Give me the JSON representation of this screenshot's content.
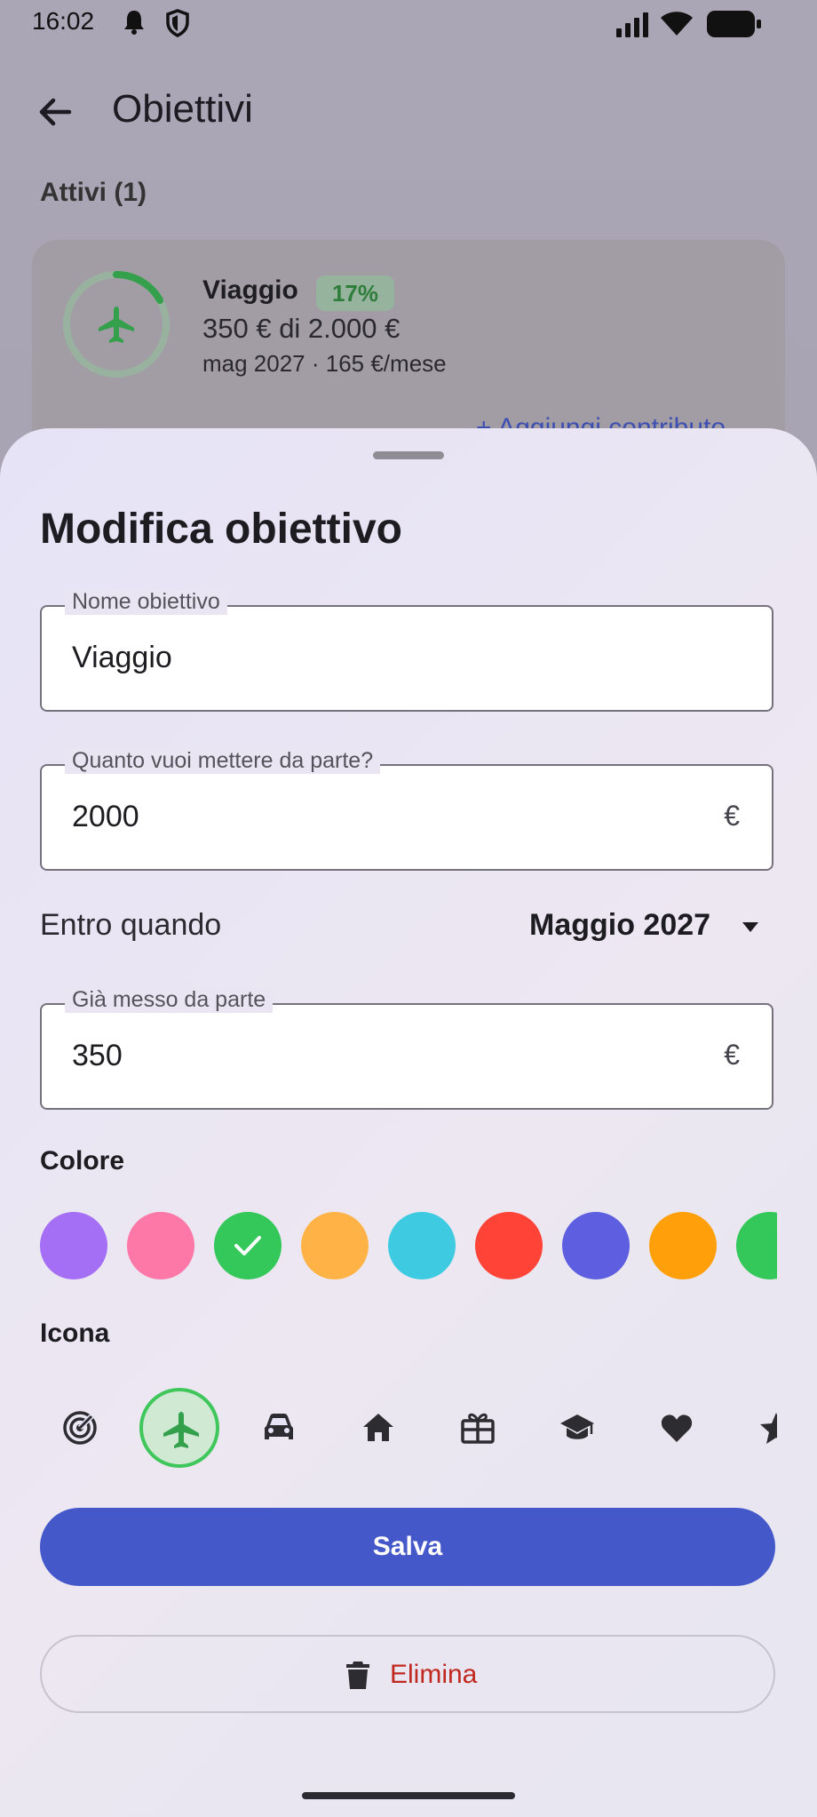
{
  "status_bar": {
    "time": "16:02"
  },
  "app_bar": {
    "title": "Obiettivi"
  },
  "section": {
    "label": "Attivi (1)"
  },
  "goal_card": {
    "name": "Viaggio",
    "percent": "17%",
    "progress": 0.17,
    "amount": "350 € di 2.000 €",
    "due": "mag 2027 · 165 €/mese",
    "add_contribution": "+ Aggiungi contributo"
  },
  "sheet": {
    "title": "Modifica obiettivo",
    "name_field": {
      "label": "Nome obiettivo",
      "value": "Viaggio"
    },
    "target_field": {
      "label": "Quanto vuoi mettere da parte?",
      "value": "2000",
      "suffix": "€"
    },
    "deadline": {
      "label": "Entro quando",
      "value": "Maggio 2027"
    },
    "saved_field": {
      "label": "Già messo da parte",
      "value": "350",
      "suffix": "€"
    },
    "color_label": "Colore",
    "colors": [
      "#a56ff5",
      "#fd77a7",
      "#34c759",
      "#ffb347",
      "#3ecbe2",
      "#ff4336",
      "#5d5fe0",
      "#ff9f0a",
      "#34c759"
    ],
    "selected_color_index": 2,
    "icon_label": "Icona",
    "icons": [
      "target-icon",
      "airplane-icon",
      "car-icon",
      "home-icon",
      "gift-icon",
      "graduation-cap-icon",
      "heart-icon",
      "star-icon"
    ],
    "selected_icon_index": 1,
    "save_label": "Salva",
    "delete_label": "Elimina",
    "accent_color": "#4558c9",
    "danger_color": "#c0281f"
  }
}
